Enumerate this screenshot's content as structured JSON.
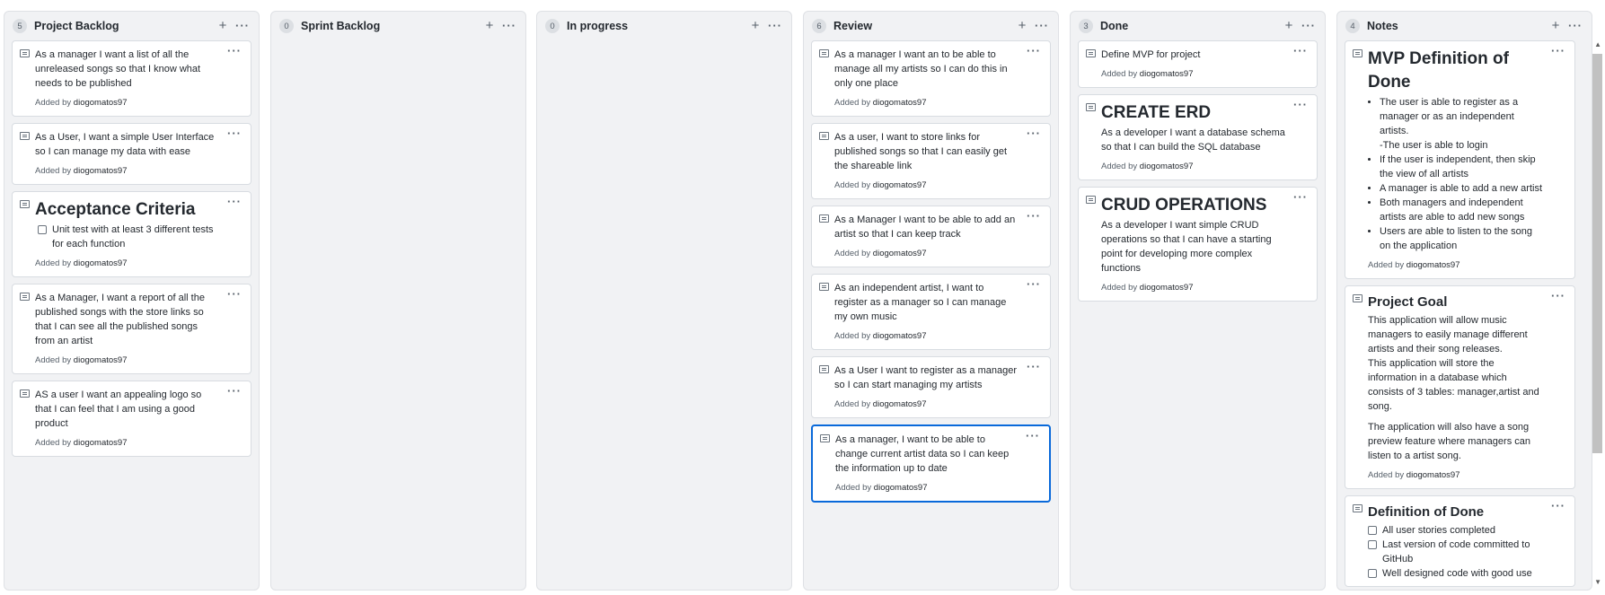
{
  "columns": [
    {
      "count": "5",
      "name": "Project Backlog",
      "cards": [
        {
          "text": "As a manager I want a list of all the unreleased songs so that I know what needs to be published",
          "added_prefix": "Added by",
          "author": "diogomatos97"
        },
        {
          "text": "As a User, I want a simple User Interface so I can manage my data with ease",
          "added_prefix": "Added by",
          "author": "diogomatos97"
        },
        {
          "heading": "Acceptance Criteria",
          "checkbox": "Unit test with at least 3 different tests for each function",
          "added_prefix": "Added by",
          "author": "diogomatos97"
        },
        {
          "text": "As a Manager, I want a report of all the published songs with the store links so that I can see all the published songs from an artist",
          "added_prefix": "Added by",
          "author": "diogomatos97"
        },
        {
          "text": "AS a user I want an appealing logo so that I can feel that I am using a good product",
          "added_prefix": "Added by",
          "author": "diogomatos97"
        }
      ]
    },
    {
      "count": "0",
      "name": "Sprint Backlog",
      "cards": []
    },
    {
      "count": "0",
      "name": "In progress",
      "cards": []
    },
    {
      "count": "6",
      "name": "Review",
      "cards": [
        {
          "text": "As a manager I want an to be able to manage all my artists so I can do this in only one place",
          "added_prefix": "Added by",
          "author": "diogomatos97"
        },
        {
          "text": "As a user, I want to store links for published songs so that I can easily get the shareable link",
          "added_prefix": "Added by",
          "author": "diogomatos97"
        },
        {
          "text": "As a Manager I want to be able to add an artist so that I can keep track",
          "added_prefix": "Added by",
          "author": "diogomatos97"
        },
        {
          "text": "As an independent artist, I want to register as a manager so I can manage my own music",
          "added_prefix": "Added by",
          "author": "diogomatos97"
        },
        {
          "text": "As a User I want to register as a manager so I can start managing my artists",
          "added_prefix": "Added by",
          "author": "diogomatos97"
        },
        {
          "text": "As a manager, I want to be able to change current artist data so I can keep the information up to date",
          "added_prefix": "Added by",
          "author": "diogomatos97"
        }
      ]
    },
    {
      "count": "3",
      "name": "Done",
      "cards": [
        {
          "text": "Define MVP for project",
          "added_prefix": "Added by",
          "author": "diogomatos97"
        },
        {
          "heading": "CREATE ERD",
          "text": "As a developer I want a database schema so that I can build the SQL database",
          "added_prefix": "Added by",
          "author": "diogomatos97"
        },
        {
          "heading": "CRUD OPERATIONS",
          "text": "As a developer I want simple CRUD operations so that I can have a starting point for developing more complex functions",
          "added_prefix": "Added by",
          "author": "diogomatos97"
        }
      ]
    },
    {
      "count": "4",
      "name": "Notes",
      "cards": [
        {
          "heading": "MVP Definition of Done",
          "bullets": [
            "The user is able to register as a manager or as an independent artists.",
            "If the user is independent, then skip the view of all artists",
            "A manager is able to add a new artist",
            "Both managers and independent artists are able to add new songs",
            "Users are able to listen to the song on the application"
          ],
          "sub_line": "-The user is able to login",
          "added_prefix": "Added by",
          "author": "diogomatos97"
        },
        {
          "heading": "Project Goal",
          "para1": "This application will allow music managers to easily manage different artists and their song releases.",
          "para2": "This application will store the information in a database which consists of 3 tables: manager,artist and song.",
          "para3": "The application will also have a song preview feature where managers can listen to a artist song.",
          "added_prefix": "Added by",
          "author": "diogomatos97"
        },
        {
          "heading": "Definition of Done",
          "checks": [
            "All user stories completed",
            "Last version of code committed to GitHub",
            "Well designed code with good use"
          ]
        }
      ]
    }
  ],
  "icons": {
    "add": "plus-icon",
    "more": "ellipsis-icon",
    "note": "note-icon"
  },
  "glyphs": {
    "plus": "+",
    "dots": "···"
  },
  "colors": {
    "selected_border": "#0969da",
    "column_bg": "#f1f2f4"
  }
}
